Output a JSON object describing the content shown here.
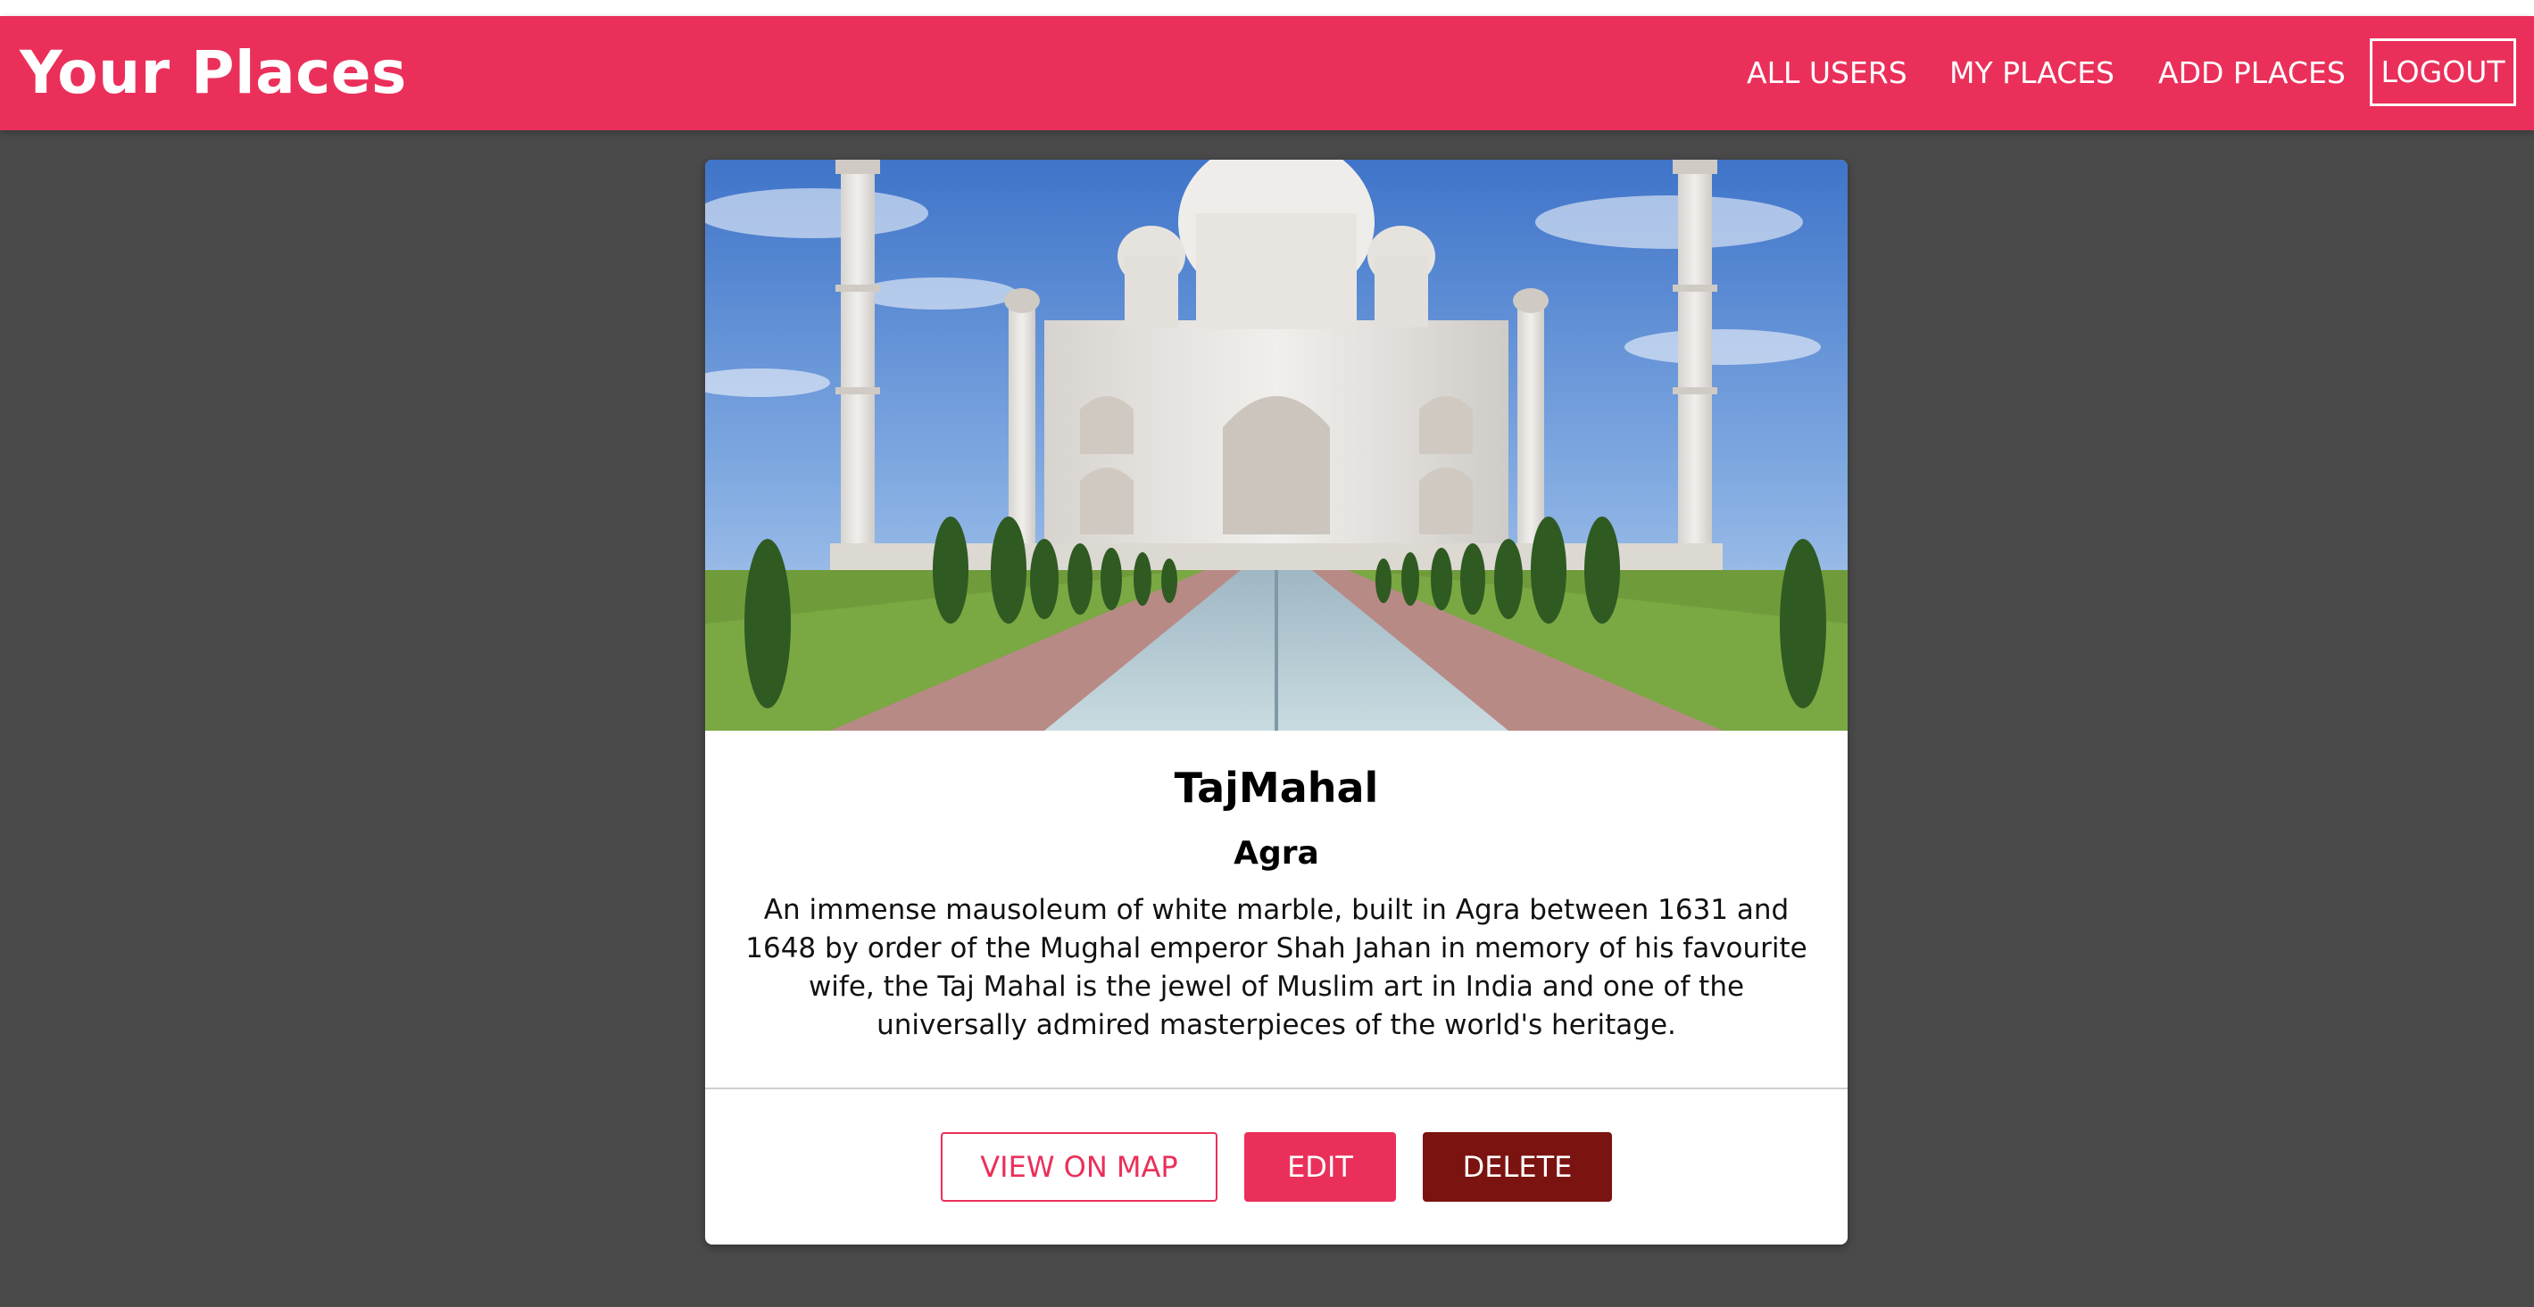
{
  "app": {
    "brand": "Your Places"
  },
  "nav": {
    "all_users": "ALL USERS",
    "my_places": "MY PLACES",
    "add_places": "ADD PLACES",
    "logout": "LOGOUT"
  },
  "place": {
    "image_alt": "TajMahal",
    "title": "TajMahal",
    "address": "Agra",
    "description": "An immense mausoleum of white marble, built in Agra between 1631 and 1648 by order of the Mughal emperor Shah Jahan in memory of his favourite wife, the Taj Mahal is the jewel of Muslim art in India and one of the universally admired masterpieces of the world's heritage."
  },
  "actions": {
    "view_on_map": "VIEW ON MAP",
    "edit": "EDIT",
    "delete": "DELETE"
  },
  "colors": {
    "primary": "#ea305a",
    "danger": "#7b1310",
    "background": "#4a4a4a"
  }
}
